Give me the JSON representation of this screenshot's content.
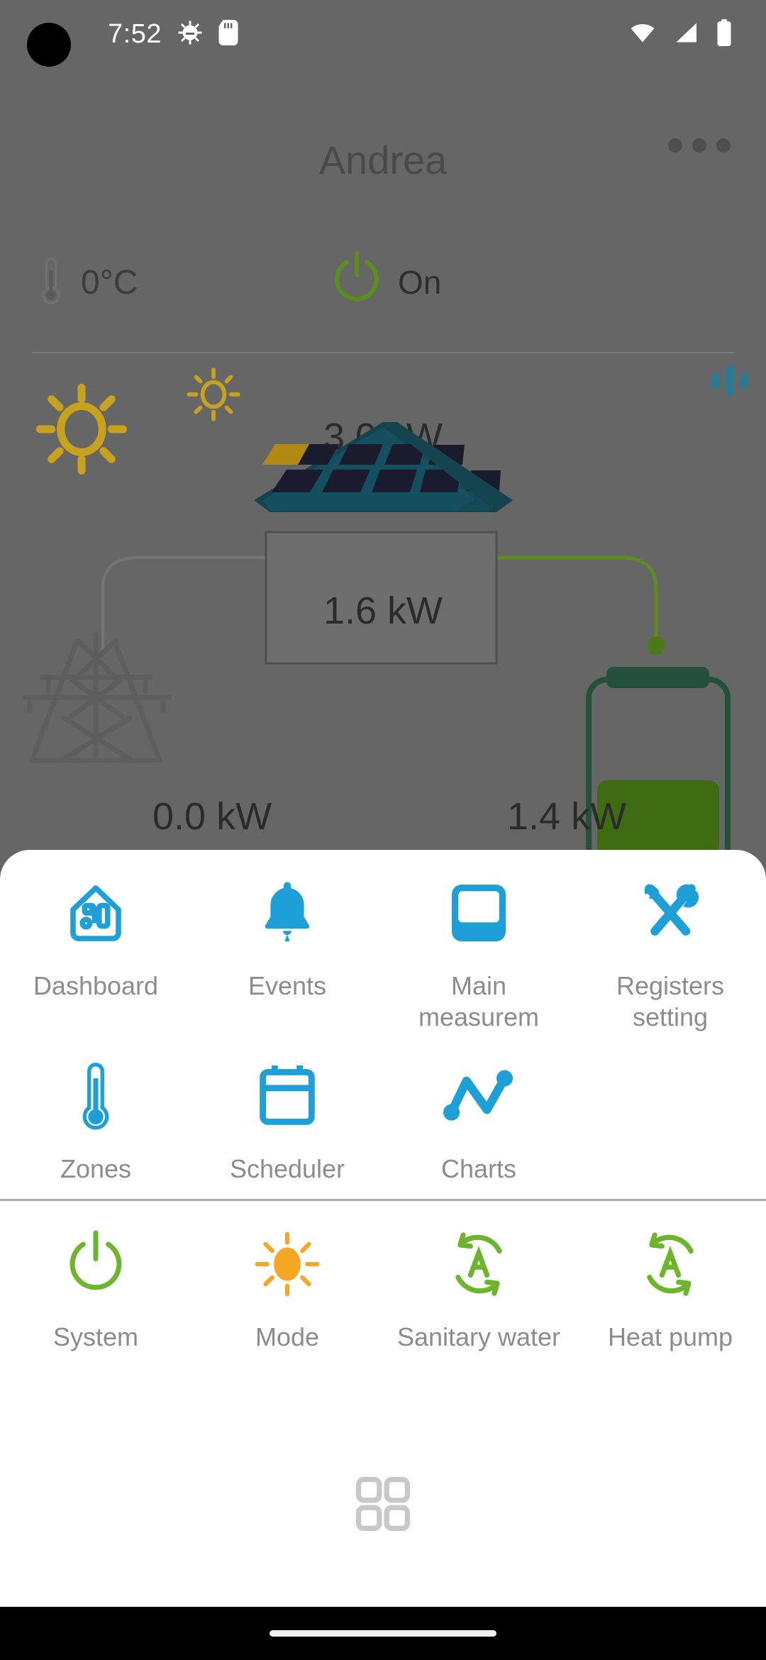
{
  "status_bar": {
    "clock": "7:52",
    "icons": [
      "android-debug-icon",
      "sd-card-icon",
      "wifi-icon",
      "cellular-signal-icon",
      "battery-icon"
    ]
  },
  "header": {
    "title": "Andrea",
    "overflow_icon": "overflow-menu-icon"
  },
  "status_row": {
    "temperature": "0°C",
    "temperature_icon": "thermometer-icon",
    "power_state": "On",
    "power_icon": "power-icon",
    "power_color": "#5a8f1e"
  },
  "energy": {
    "solar_icon_large": "sun-icon",
    "solar_icon_small": "sun-small-icon",
    "equalizer_icon": "equalizer-icon",
    "solar_power": "3.0 kW",
    "house_power": "1.6 kW",
    "grid_power": "0.0 kW",
    "battery_power": "1.4 kW",
    "grid_icon": "pylon-icon",
    "battery_icon": "battery-storage-icon",
    "house_icon": "house-solar-icon",
    "battery_level_percent": 40,
    "colors": {
      "solar": "#c8a21c",
      "roof": "#13444f",
      "panel": "#1b1b2e",
      "panel_active": "#b28a12",
      "battery_fill": "#3f6b12",
      "battery_outline": "#25503c",
      "grid_wire": "#757575",
      "battery_wire": "#5a8f1e",
      "equalizer": "#2a7a94"
    }
  },
  "menu": {
    "accent": "#1f9fd8",
    "green": "#6cb52d",
    "orange": "#f5a623",
    "rows": [
      [
        {
          "label": "Dashboard",
          "icon": "home-assistant-icon",
          "color": "#1f9fd8"
        },
        {
          "label": "Events",
          "icon": "bell-icon",
          "color": "#1f9fd8"
        },
        {
          "label": "Main measurem",
          "icon": "device-measure-icon",
          "color": "#1f9fd8"
        },
        {
          "label": "Registers setting",
          "icon": "tools-icon",
          "color": "#1f9fd8"
        }
      ],
      [
        {
          "label": "Zones",
          "icon": "thermometer-icon",
          "color": "#1f9fd8"
        },
        {
          "label": "Scheduler",
          "icon": "calendar-icon",
          "color": "#1f9fd8"
        },
        {
          "label": "Charts",
          "icon": "line-chart-icon",
          "color": "#1f9fd8"
        }
      ],
      [
        {
          "label": "System",
          "icon": "power-icon",
          "color": "#6cb52d"
        },
        {
          "label": "Mode",
          "icon": "sun-icon",
          "color": "#f5a623"
        },
        {
          "label": "Sanitary water",
          "icon": "auto-mode-icon",
          "color": "#6cb52d"
        },
        {
          "label": "Heat pump",
          "icon": "auto-mode-icon",
          "color": "#6cb52d"
        }
      ]
    ],
    "nav_icon": "grid-apps-icon"
  }
}
